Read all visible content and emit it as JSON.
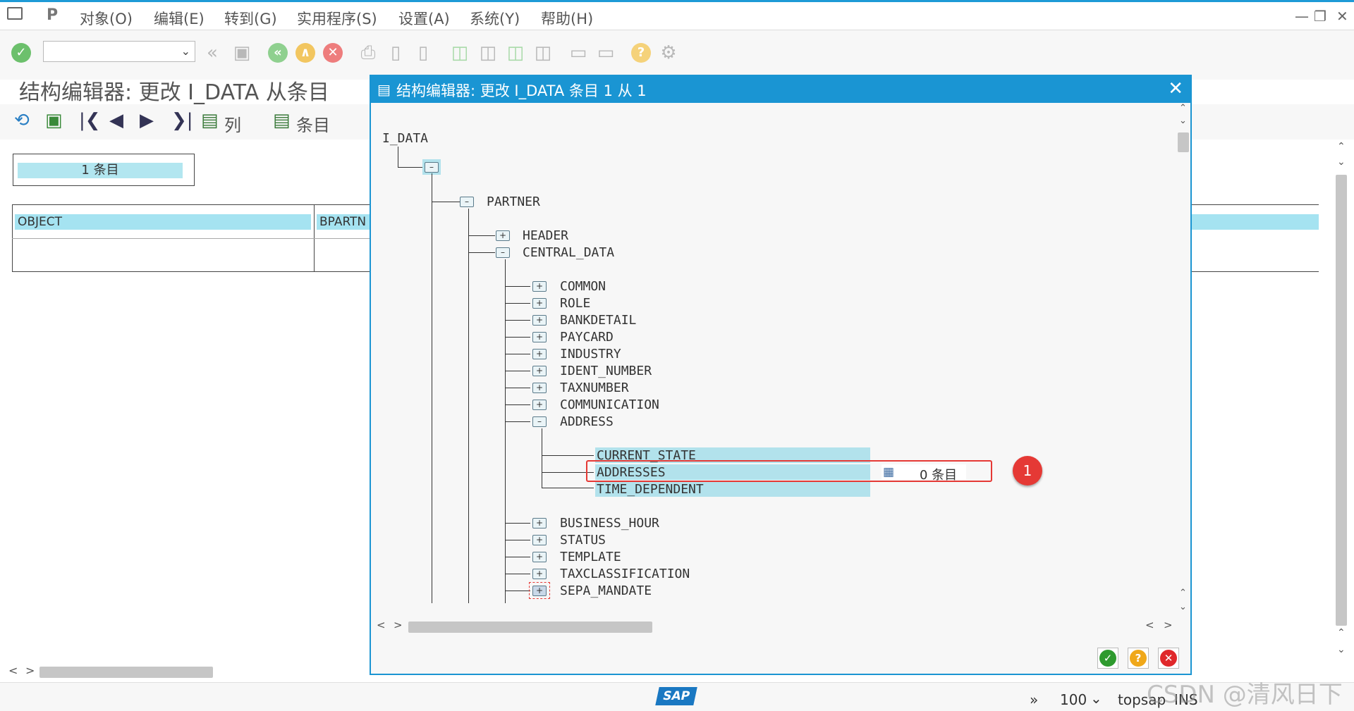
{
  "menubar": {
    "items": [
      "对象(O)",
      "编辑(E)",
      "转到(G)",
      "实用程序(S)",
      "设置(A)",
      "系统(Y)",
      "帮助(H)"
    ]
  },
  "page_title": "结构编辑器: 更改 I_DATA 从条目",
  "app_toolbar": {
    "col_label": "列",
    "entry_label": "条目"
  },
  "entry_box": {
    "count_label": "1 条目"
  },
  "table": {
    "columns": [
      "OBJECT",
      "BPARTN"
    ]
  },
  "dialog": {
    "title": "结构编辑器: 更改 I_DATA 条目 1 从 1",
    "tree": {
      "root": "I_DATA",
      "partner": "PARTNER",
      "header": "HEADER",
      "central_data": "CENTRAL_DATA",
      "common": "COMMON",
      "role": "ROLE",
      "bankdetail": "BANKDETAIL",
      "paycard": "PAYCARD",
      "industry": "INDUSTRY",
      "ident_number": "IDENT_NUMBER",
      "taxnumber": "TAXNUMBER",
      "communication": "COMMUNICATION",
      "address": "ADDRESS",
      "current_state": "CURRENT_STATE",
      "addresses": "ADDRESSES",
      "addresses_count": "0 条目",
      "time_dependent": "TIME_DEPENDENT",
      "business_hour": "BUSINESS_HOUR",
      "status": "STATUS",
      "template": "TEMPLATE",
      "taxclassification": "TAXCLASSIFICATION",
      "sepa_mandate": "SEPA_MANDATE"
    }
  },
  "callout": {
    "badge": "1"
  },
  "status_bar": {
    "zoom": "100",
    "server": "topsap",
    "mode": "INS"
  },
  "watermark": "CSDN @清风日下",
  "colors": {
    "dialog_title_bg": "#1a95d3",
    "highlight": "#b2e2ec",
    "callout": "#e53935"
  },
  "icons": [
    "check-icon",
    "save-icon",
    "back-icon",
    "exit-icon",
    "cancel-icon",
    "print-icon",
    "find-icon",
    "help-icon",
    "gear-icon",
    "sap-logo"
  ]
}
